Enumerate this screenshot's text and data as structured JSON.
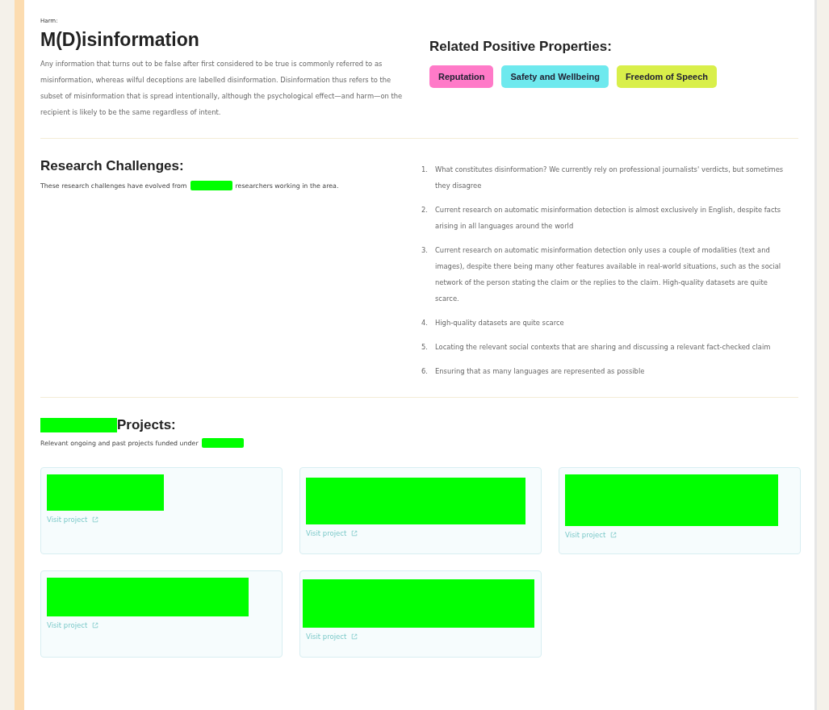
{
  "harm": {
    "label": "Harm:",
    "title": "M(D)isinformation",
    "description": "Any information that turns out to be false after first considered to be true is commonly referred to as misinformation, whereas wilful deceptions are labelled disinformation. Disinformation thus refers to the subset of misinformation that is spread intentionally, although the psychological effect—and harm—on the recipient is likely to be the same regardless of intent."
  },
  "related": {
    "heading": "Related Positive Properties:",
    "tags": [
      {
        "label": "Reputation",
        "color": "#ff7ac8"
      },
      {
        "label": "Safety and Wellbeing",
        "color": "#6ee9ee"
      },
      {
        "label": "Freedom of Speech",
        "color": "#d9ef4a"
      }
    ]
  },
  "research": {
    "heading": "Research Challenges:",
    "intro": [
      {
        "kind": "text",
        "text": "These research challenges have evolved from"
      },
      {
        "kind": "redacted"
      },
      {
        "kind": "text",
        "text": "researchers working in the area."
      }
    ],
    "challenges": [
      {
        "number": "1.",
        "text": "What constitutes disinformation? We currently rely on professional journalists' verdicts, but sometimes they disagree"
      },
      {
        "number": "2.",
        "text": "Current research on automatic misinformation detection is almost exclusively in English, despite facts arising in all languages around the world"
      },
      {
        "number": "3.",
        "text": "Current research on automatic misinformation detection only uses a couple of modalities (text and images), despite there being many other features available in real-world situations, such as the social network of the person stating the claim or the replies to the claim. High-quality datasets are quite scarce."
      },
      {
        "number": "4.",
        "text": "High-quality datasets are quite scarce"
      },
      {
        "number": "5.",
        "text": "Locating the relevant social contexts that are sharing and discussing a relevant fact-checked claim"
      },
      {
        "number": "6.",
        "text": "Ensuring that as many languages are represented as possible"
      }
    ]
  },
  "projects": {
    "heading": [
      {
        "kind": "redacted"
      },
      {
        "kind": "text",
        "text": "Projects:"
      }
    ],
    "intro": [
      {
        "kind": "text",
        "text": "Relevant ongoing and past projects funded under"
      },
      {
        "kind": "redacted"
      }
    ],
    "cards": [
      {
        "kind": "redacted",
        "link": "Visit project"
      },
      {
        "kind": "redacted",
        "link": "Visit project"
      },
      {
        "kind": "redacted",
        "link": "Visit project"
      },
      {
        "kind": "redacted",
        "link": "Visit project"
      },
      {
        "kind": "redacted",
        "link": "Visit project"
      }
    ]
  }
}
